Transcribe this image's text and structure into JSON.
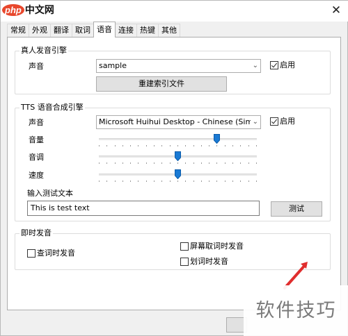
{
  "app": {
    "logo_badge": "php",
    "logo_text": "中文网"
  },
  "window": {
    "close_glyph": "✕"
  },
  "tabs": [
    {
      "label": "常规"
    },
    {
      "label": "外观"
    },
    {
      "label": "翻译"
    },
    {
      "label": "取词"
    },
    {
      "label": "语音",
      "active": true
    },
    {
      "label": "连接"
    },
    {
      "label": "热键"
    },
    {
      "label": "其他"
    }
  ],
  "real_voice": {
    "title": "真人发音引擎",
    "voice_label": "声音",
    "voice_value": "sample",
    "enable_label": "启用",
    "enabled": true,
    "rebuild_button": "重建索引文件"
  },
  "tts": {
    "title": "TTS 语音合成引擎",
    "voice_label": "声音",
    "voice_value": "Microsoft Huihui Desktop - Chinese (Simplifie",
    "enable_label": "启用",
    "enabled": true,
    "volume_label": "音量",
    "volume_level": 0.75,
    "pitch_label": "音调",
    "pitch_level": 0.5,
    "speed_label": "速度",
    "speed_level": 0.5,
    "test_text_label": "输入测试文本",
    "test_text_value": "This is test text",
    "test_button": "测试"
  },
  "instant": {
    "title": "即时发音",
    "lookup_label": "查词时发音",
    "lookup_checked": false,
    "screen_capture_label": "屏幕取词时发音",
    "screen_capture_checked": false,
    "highlight_label": "划词时发音",
    "highlight_checked": false
  },
  "watermark": {
    "text": "软件技巧"
  },
  "colors": {
    "slider_thumb": "#1a7ad4",
    "arrow": "#e02d2d",
    "logo_badge": "#e8472c"
  },
  "icons": {
    "dropdown": "chevron-down-icon",
    "checkbox": "checkbox-icon",
    "close": "close-icon"
  }
}
